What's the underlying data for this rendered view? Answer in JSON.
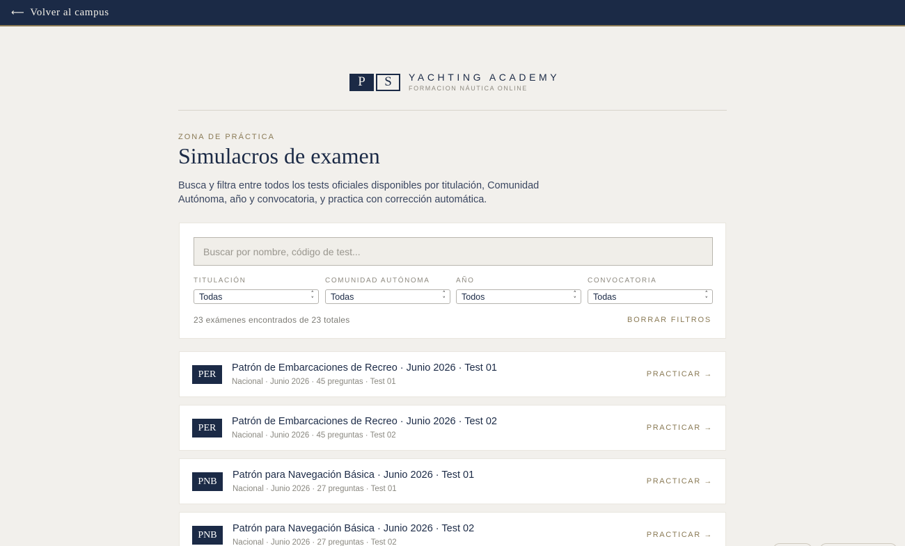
{
  "topbar": {
    "back_icon": "arrow-left-icon",
    "back_label": "Volver al campus"
  },
  "brand": {
    "mono_left": "P",
    "mono_right": "S",
    "title": "YACHTING ACADEMY",
    "subtitle": "FORMACION NÁUTICA ONLINE"
  },
  "header": {
    "eyebrow": "ZONA DE PRÁCTICA",
    "title": "Simulacros de examen",
    "intro": "Busca y filtra entre todos los tests oficiales disponibles por titulación, Comunidad Autónoma, año y convocatoria, y practica con corrección automática."
  },
  "filters": {
    "search_placeholder": "Buscar por nombre, código de test...",
    "items": [
      {
        "label": "TITULACIÓN",
        "value": "Todas"
      },
      {
        "label": "COMUNIDAD AUTÓNOMA",
        "value": "Todas"
      },
      {
        "label": "AÑO",
        "value": "Todos"
      },
      {
        "label": "CONVOCATORIA",
        "value": "Todas"
      }
    ],
    "result_count": "23 exámenes encontrados de 23 totales",
    "clear_label": "BORRAR FILTROS"
  },
  "exams": [
    {
      "badge": "PER",
      "title": "Patrón de Embarcaciones de Recreo · Junio 2026 · Test 01",
      "meta": "Nacional · Junio 2026 · 45 preguntas · Test 01",
      "action": "PRACTICAR →"
    },
    {
      "badge": "PER",
      "title": "Patrón de Embarcaciones de Recreo · Junio 2026 · Test 02",
      "meta": "Nacional · Junio 2026 · 45 preguntas · Test 02",
      "action": "PRACTICAR →"
    },
    {
      "badge": "PNB",
      "title": "Patrón para Navegación Básica · Junio 2026 · Test 01",
      "meta": "Nacional · Junio 2026 · 27 preguntas · Test 01",
      "action": "PRACTICAR →"
    },
    {
      "badge": "PNB",
      "title": "Patrón para Navegación Básica · Junio 2026 · Test 02",
      "meta": "Nacional · Junio 2026 · 27 preguntas · Test 02",
      "action": "PRACTICAR →"
    }
  ],
  "colors": {
    "navy": "#1b2a46",
    "gold": "#8a7a55",
    "background": "#f2f0ec"
  }
}
